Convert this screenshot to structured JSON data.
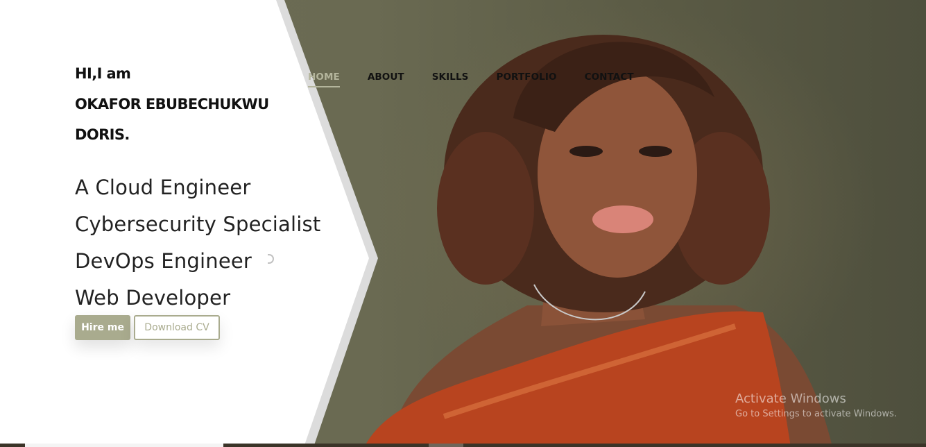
{
  "hero": {
    "greeting_line1": "HI,I am",
    "greeting_line2": "OKAFOR EBUBECHUKWU",
    "greeting_line3": "DORIS.",
    "roles": [
      "A Cloud Engineer",
      "Cybersecurity Specialist",
      "DevOps Engineer",
      "Web Developer"
    ],
    "hire_label": "Hire me",
    "cv_label": "Download CV"
  },
  "nav": {
    "items": [
      {
        "label": "HOME",
        "active": true
      },
      {
        "label": "ABOUT",
        "active": false
      },
      {
        "label": "SKILLS",
        "active": false
      },
      {
        "label": "PORTFOLIO",
        "active": false
      },
      {
        "label": "CONTACT",
        "active": false
      }
    ]
  },
  "watermark": {
    "title": "Activate Windows",
    "subtitle": "Go to Settings to activate Windows."
  },
  "colors": {
    "accent": "#a9ab8e",
    "nav_active": "#b4b59c",
    "dress": "#b8441f",
    "background": "#6a6a52"
  }
}
